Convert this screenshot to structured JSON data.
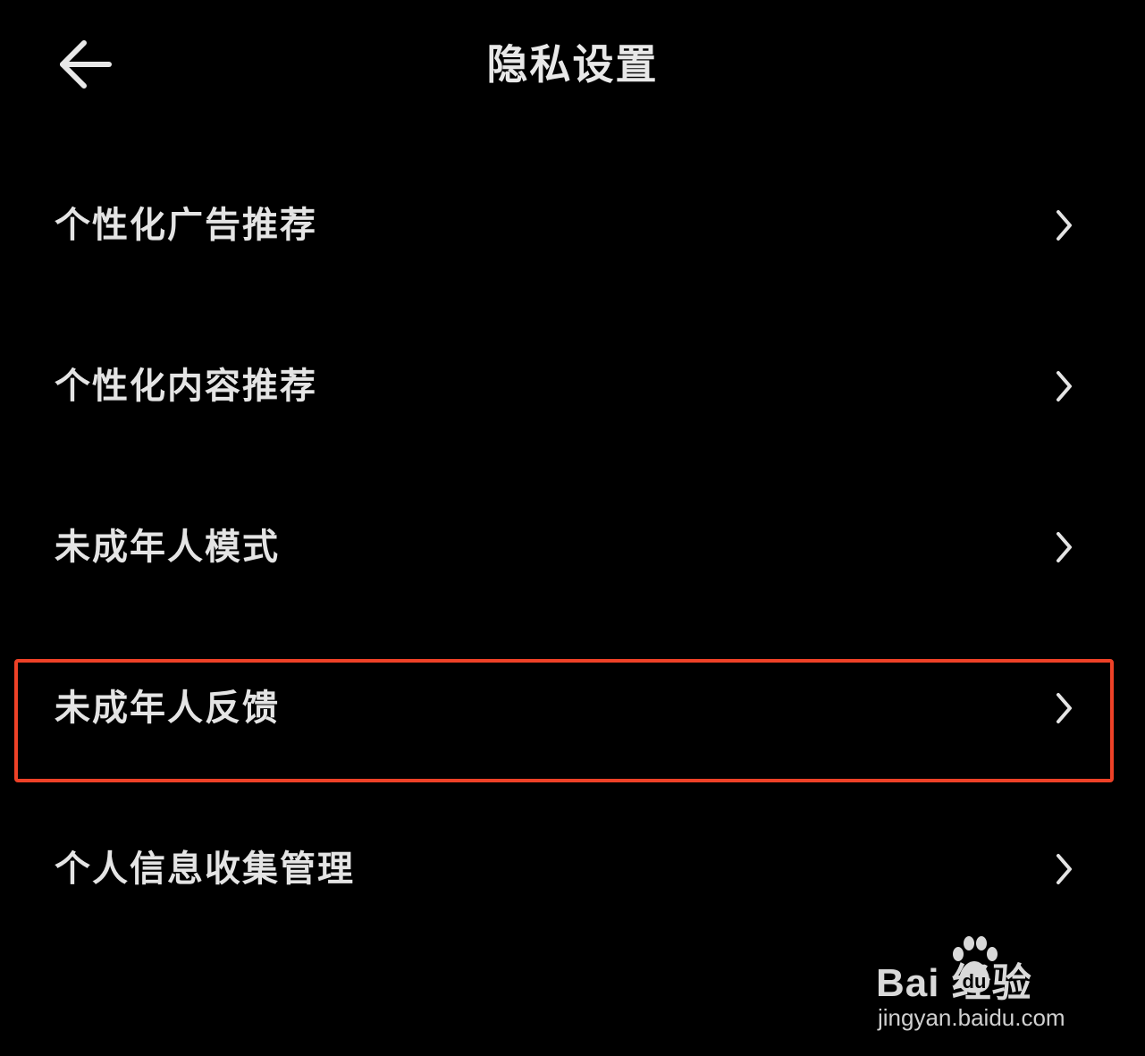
{
  "header": {
    "title": "隐私设置",
    "back_icon": "arrow-left-icon"
  },
  "menu": {
    "items": [
      {
        "label": "个性化广告推荐",
        "icon": "chevron-right-icon"
      },
      {
        "label": "个性化内容推荐",
        "icon": "chevron-right-icon"
      },
      {
        "label": "未成年人模式",
        "icon": "chevron-right-icon"
      },
      {
        "label": "未成年人反馈",
        "icon": "chevron-right-icon",
        "highlighted": true
      },
      {
        "label": "个人信息收集管理",
        "icon": "chevron-right-icon"
      }
    ]
  },
  "highlight": {
    "color": "#ee4127"
  },
  "watermark": {
    "brand": "Bai  经验",
    "url": "jingyan.baidu.com"
  },
  "colors": {
    "background": "#000000",
    "text": "#e4e4e4"
  }
}
